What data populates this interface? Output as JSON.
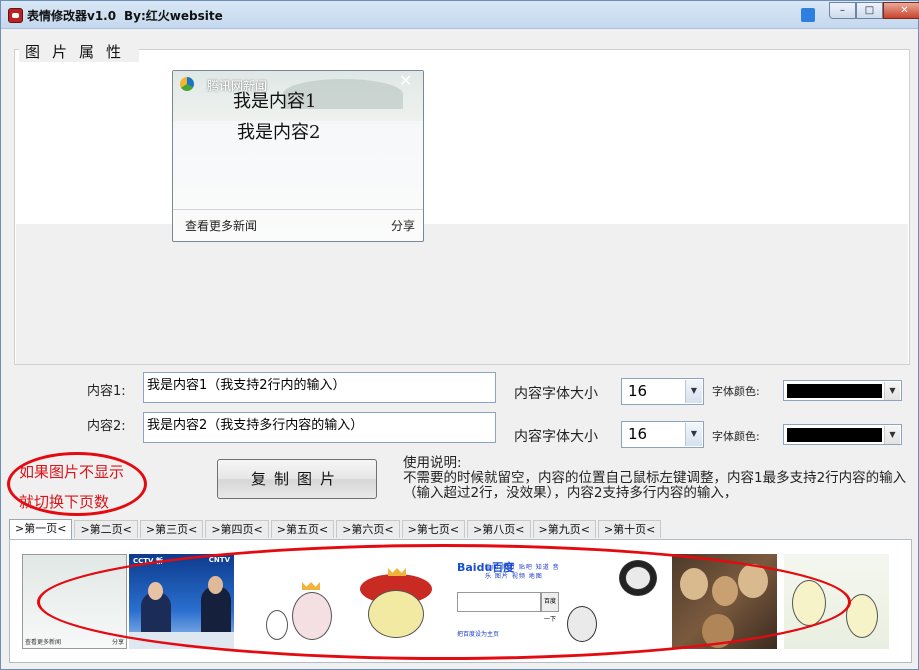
{
  "window": {
    "title": "表情修改器v1.0",
    "author": "By:红火website",
    "controls": [
      "–",
      "□",
      "✕"
    ]
  },
  "group": {
    "legend": "图片属性"
  },
  "preview": {
    "source": "腾讯网新闻",
    "line1": "我是内容1",
    "line2": "我是内容2",
    "more_link": "查看更多新闻",
    "share": "分享"
  },
  "form": {
    "content1_label": "内容1:",
    "content1_value": "我是内容1（我支持2行内的输入）",
    "content2_label": "内容2:",
    "content2_value": "我是内容2（我支持多行内容的输入）",
    "font_size_label1": "内容字体大小",
    "font_size_value1": "16",
    "font_size_label2": "内容字体大小",
    "font_size_value2": "16",
    "font_color_label1": "字体颜色:",
    "font_color_label2": "字体颜色:",
    "font_color_value": "#000000"
  },
  "hint": {
    "line1": "如果图片不显示",
    "line2": "就切换下页数"
  },
  "copy_button": "复制图片",
  "usage": {
    "title": "使用说明:",
    "text": "不需要的时候就留空，内容的位置自己鼠标左键调整，内容1最多支持2行内容的输入（输入超过2行，没效果），内容2支持多行内容的输入，"
  },
  "tabs": [
    ">第一页<",
    ">第二页<",
    ">第三页<",
    ">第四页<",
    ">第五页<",
    ">第六页<",
    ">第七页<",
    ">第八页<",
    ">第九页<",
    ">第十页<"
  ],
  "thumbs": {
    "t1_caption": "查看更多新闻",
    "t1_share": "分享",
    "t2_left": "CCTV 新",
    "t2_right": "CNTV",
    "t5_logo_a": "Bai",
    "t5_logo_b": "du百度",
    "t5_links": "新闻 网页 贴吧 知道 音乐 图片 视频 地图",
    "t5_btn": "百度一下",
    "t5_foot": "把百度设为主页"
  },
  "colors": {
    "hint_red": "#d9141a",
    "window_border": "#6e8fb3"
  }
}
